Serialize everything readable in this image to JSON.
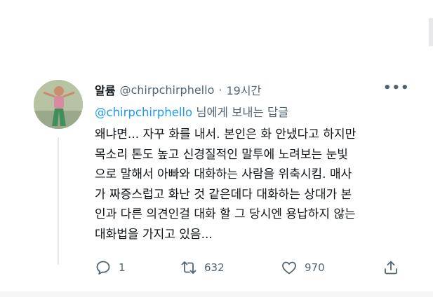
{
  "tweet": {
    "display_name": "알륨",
    "handle": "@chirpchirphello",
    "separator": "·",
    "time": "19시간",
    "more_label": "•••",
    "reply_to": {
      "mention": "@chirpchirphello",
      "suffix": " 님에게 보내는 답글"
    },
    "body_lines": [
      "왜냐면... 자꾸 화를 내서. 본인은 화 안냈다고 하지만",
      "목소리 톤도 높고 신경질적인 말투에 노려보는 눈빛",
      "으로 말해서 아빠와 대화하는 사람을 위축시킴. 매사",
      "가 짜증스럽고 화난 것 같은데다 대화하는 상대가 본",
      "인과 다른 의견인걸 대화 할 그 당시엔 용납하지 않는",
      "대화법을 가지고 있음..."
    ],
    "actions": {
      "reply": {
        "icon": "reply-icon",
        "count": "1"
      },
      "retweet": {
        "icon": "retweet-icon",
        "count": "632"
      },
      "like": {
        "icon": "heart-icon",
        "count": "970"
      },
      "share": {
        "icon": "share-icon"
      }
    }
  },
  "colors": {
    "text_primary": "#0f1419",
    "text_secondary": "#536471",
    "accent": "#1d9bf0",
    "thread_line": "#e4e8eb"
  }
}
